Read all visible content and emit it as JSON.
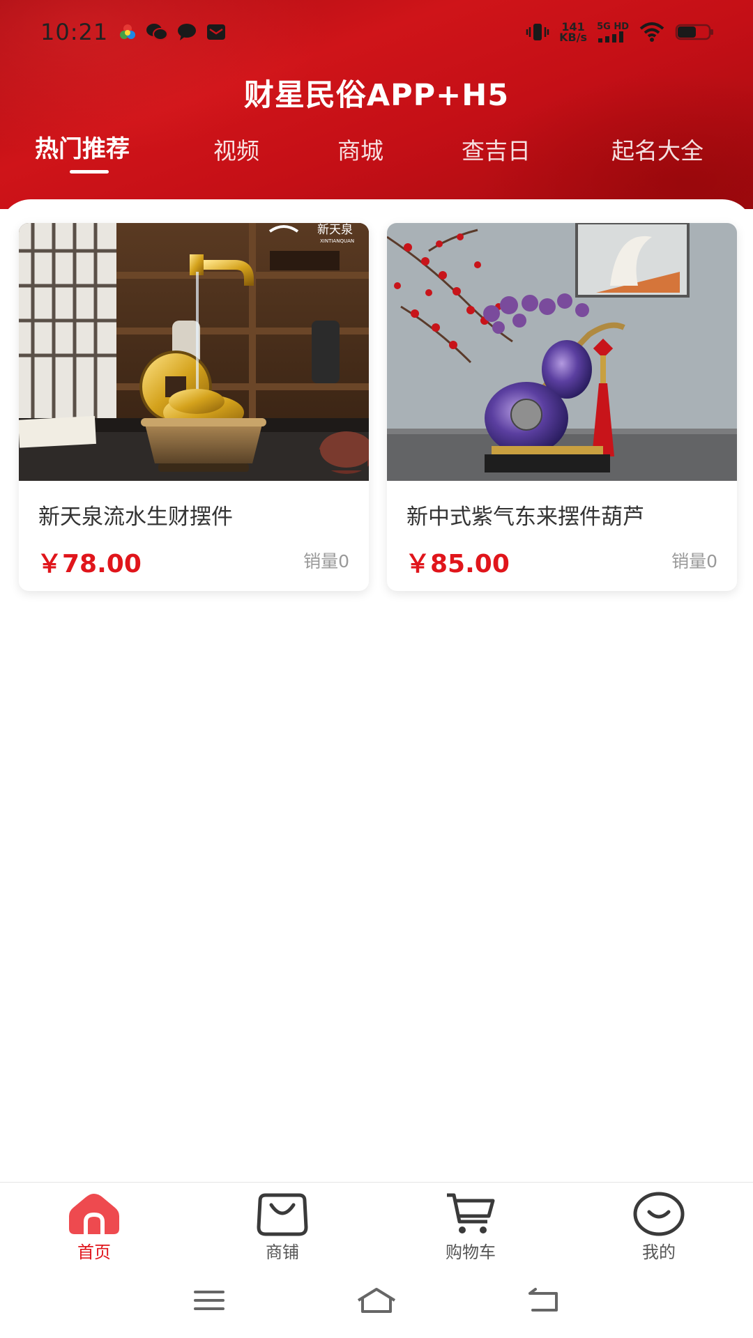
{
  "status_bar": {
    "time": "10:21",
    "net_speed_value": "141",
    "net_speed_unit": "KB/s",
    "network_label": "5G HD"
  },
  "header": {
    "title": "财星民俗APP+H5"
  },
  "tabs": [
    {
      "label": "热门推荐",
      "active": true
    },
    {
      "label": "视频"
    },
    {
      "label": "商城"
    },
    {
      "label": "查吉日"
    },
    {
      "label": "起名大全"
    }
  ],
  "products": [
    {
      "title": "新天泉流水生财摆件",
      "price": "￥78.00",
      "sales": "销量0",
      "image_brand": "新天泉",
      "image_brand_sub": "XINTIANQUAN"
    },
    {
      "title": "新中式紫气东来摆件葫芦",
      "price": "￥85.00",
      "sales": "销量0"
    }
  ],
  "bottom_nav": [
    {
      "label": "首页",
      "icon": "home-icon",
      "active": true
    },
    {
      "label": "商铺",
      "icon": "shop-bag-icon"
    },
    {
      "label": "购物车",
      "icon": "cart-icon"
    },
    {
      "label": "我的",
      "icon": "smile-icon"
    }
  ],
  "colors": {
    "brand_red": "#c8141a",
    "price_red": "#e0151b",
    "nav_active": "#e0151b",
    "muted": "#999999"
  }
}
